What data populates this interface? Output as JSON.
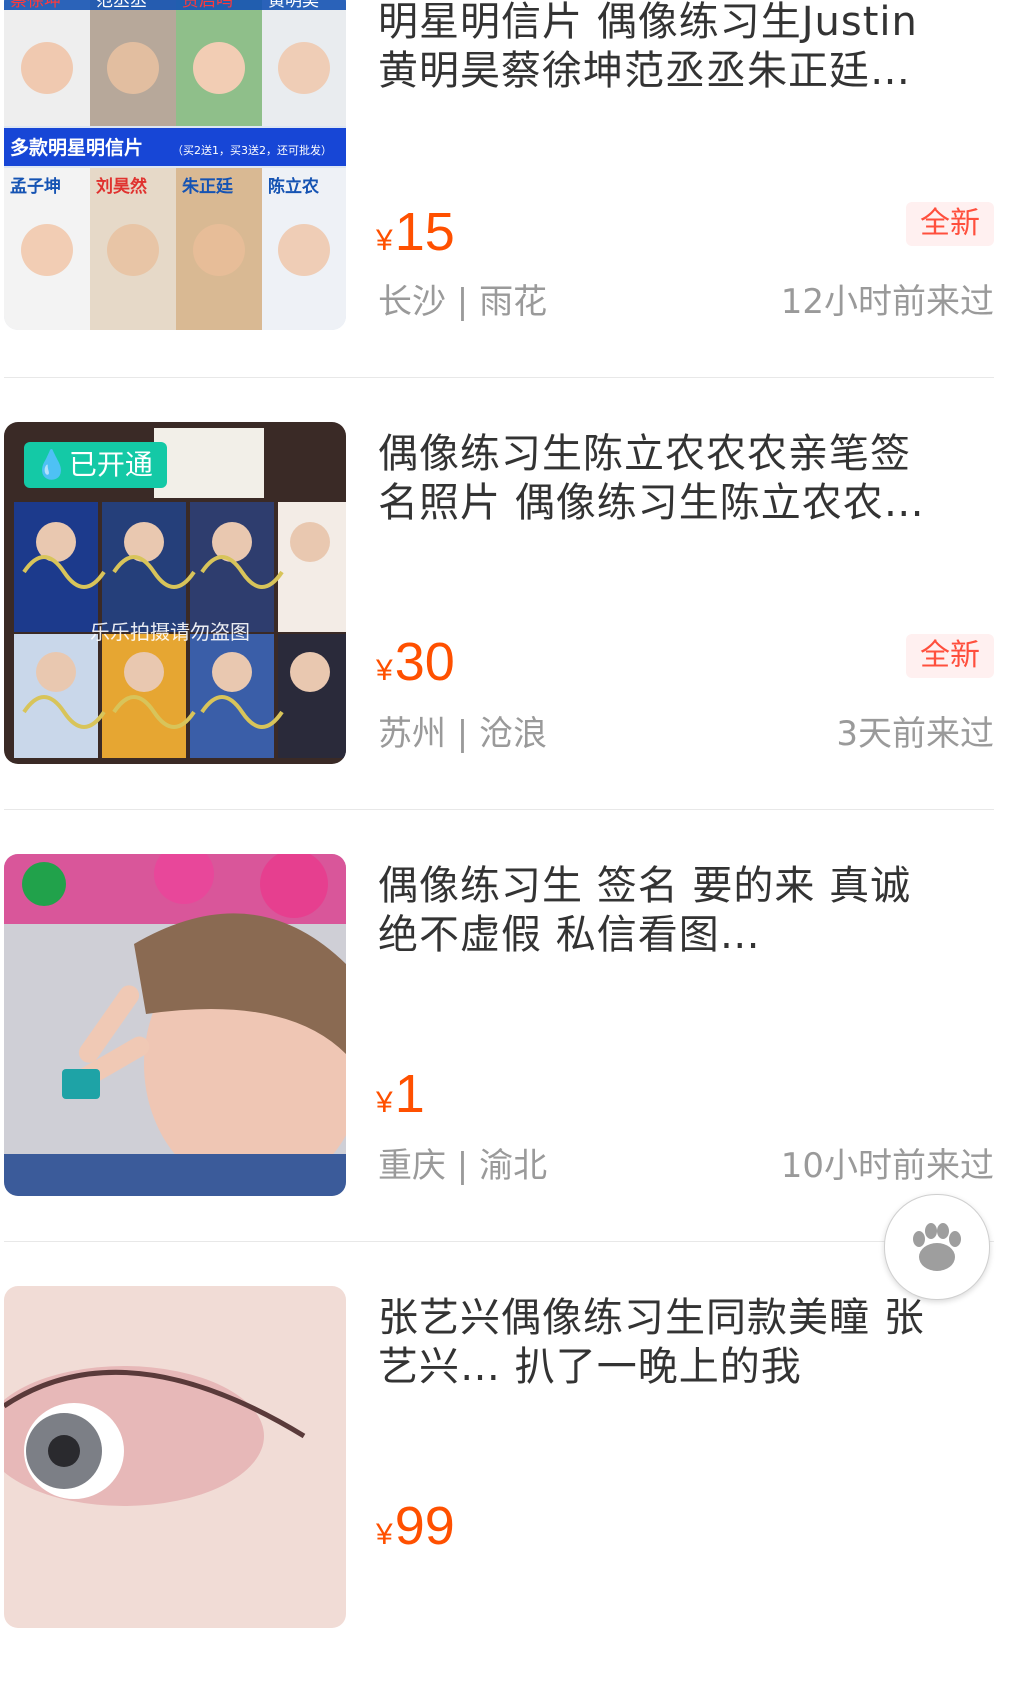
{
  "items": [
    {
      "title_line1": "明星明信片 偶像练习生Justin",
      "title_line2": "黄明昊蔡徐坤范丞丞朱正廷…",
      "currency": "¥",
      "price": "15",
      "badge": "全新",
      "location": "长沙 | 雨花",
      "visited": "12小时前来过",
      "thumb_text": {
        "cards_top": [
          "蔡徐坤",
          "范丞丞",
          "贾启鸣",
          "黄明昊"
        ],
        "banner": "多款明星明信片",
        "banner_sub": "（买2送1，买3送2，还可批发）",
        "cards_bottom": [
          "孟子坤",
          "刘昊然",
          "朱正廷",
          "陈立农"
        ]
      }
    },
    {
      "title_line1": "偶像练习生陈立农农农亲笔签",
      "title_line2": "名照片 偶像练习生陈立农农…",
      "currency": "¥",
      "price": "30",
      "badge": "全新",
      "location": "苏州 | 沧浪",
      "visited": "3天前来过",
      "tag": "已开通",
      "watermark": "乐乐拍摄请勿盗图"
    },
    {
      "title_line1": "偶像练习生 签名 要的来 真诚",
      "title_line2": "绝不虚假 私信看图…",
      "currency": "¥",
      "price": "1",
      "location": "重庆 | 渝北",
      "visited": "10小时前来过"
    },
    {
      "title_line1": "张艺兴偶像练习生同款美瞳 张",
      "title_line2": "艺兴… 扒了一晚上的我",
      "currency": "¥",
      "price": "99"
    }
  ],
  "float_button": {
    "icon": "paw-icon"
  },
  "colors": {
    "price": "#ff5000",
    "badge_bg": "#fff0f0",
    "badge_text": "#ff4f3d",
    "tag_bg": "#14c9a6"
  }
}
